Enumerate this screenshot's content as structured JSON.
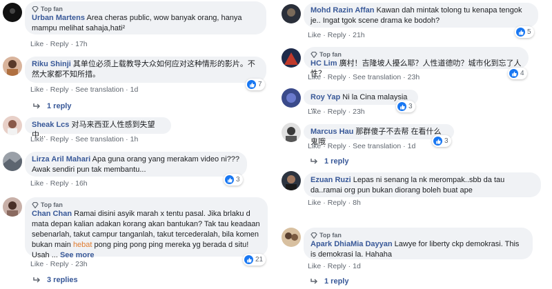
{
  "labels": {
    "top_fan": "Top fan",
    "like": "Like",
    "reply": "Reply",
    "see_translation": "See translation",
    "sep": "·"
  },
  "comments_left": [
    {
      "author": "Urban Martens",
      "top_fan": true,
      "text": "Area cheras public, wow banyak orang, hanya mampu melihat sahaja,hati²",
      "time": "17h",
      "translation": false,
      "likes": null,
      "replies": null
    },
    {
      "author": "Riku Shinji",
      "top_fan": false,
      "text": "其单位必须上载教导大众如何应对这种情形的影片。不然大家都不知所措。",
      "time": "1d",
      "translation": true,
      "likes": "7",
      "replies": "1 reply"
    },
    {
      "author": "Sheak Lcs",
      "top_fan": false,
      "text": "对马来西亚人性感到失望中...",
      "time": "1h",
      "translation": true,
      "likes": null,
      "replies": null
    },
    {
      "author": "Lirza Aril Mahari",
      "top_fan": false,
      "text": "Apa guna orang yang merakam video ni??? Awak sendiri pun tak membantu...",
      "time": "16h",
      "translation": false,
      "likes": "3",
      "replies": null
    },
    {
      "author": "Chan Chan",
      "top_fan": true,
      "text_before": "Ramai disini asyik marah x tentu pasal. Jika brlaku d mata depan kalian adakan korang akan bantukan? Tak tau keadaan sebenarlah, takut campur tanganlah, takut tercederalah, bila komen bukan main ",
      "link_word": "hebat",
      "text_after": " pong ping pong ping mereka yg berada d situ! Usah ... ",
      "see_more": "See more",
      "time": "23h",
      "translation": false,
      "likes": "21",
      "replies": "3 replies"
    }
  ],
  "comments_right": [
    {
      "author": "Mohd Razin Affan",
      "top_fan": false,
      "text": "Kawan dah mintak tolong tu kenapa tengok je.. Ingat tgok scene drama ke bodoh?",
      "time": "21h",
      "translation": false,
      "likes": "5",
      "replies": null
    },
    {
      "author": "HC Lim",
      "top_fan": true,
      "text": "廣村！吉隆坡人擾么耶？人性道德叻？城市化到忘了人性？",
      "time": "23h",
      "translation": true,
      "likes": "4",
      "replies": null
    },
    {
      "author": "Roy Yap",
      "top_fan": false,
      "text": "Ni la Cina malaysia ...",
      "time": "23h",
      "translation": false,
      "likes": "3",
      "replies": null
    },
    {
      "author": "Marcus Hau",
      "top_fan": false,
      "text": "那群傻子不去帮 在看什么鬼哦",
      "time": "1d",
      "translation": true,
      "likes": "3",
      "replies": "1 reply"
    },
    {
      "author": "Ezuan Ruzi",
      "top_fan": false,
      "text": "Lepas ni senang la nk merompak..sbb da tau da..ramai org pun bukan diorang boleh buat ape",
      "time": "8h",
      "translation": false,
      "likes": null,
      "replies": null
    },
    {
      "author": "Apark DhiaMia Dayyan",
      "top_fan": true,
      "text": "Lawye for liberty ckp demokrasi. This is demokrasi la. Hahaha",
      "time": "1d",
      "translation": false,
      "likes": null,
      "replies": "1 reply"
    }
  ],
  "colors": {
    "bubble": "#f0f2f5",
    "author": "#385898",
    "meta": "#606770",
    "like_blue": "#1877f2",
    "link": "#e07b2e"
  }
}
